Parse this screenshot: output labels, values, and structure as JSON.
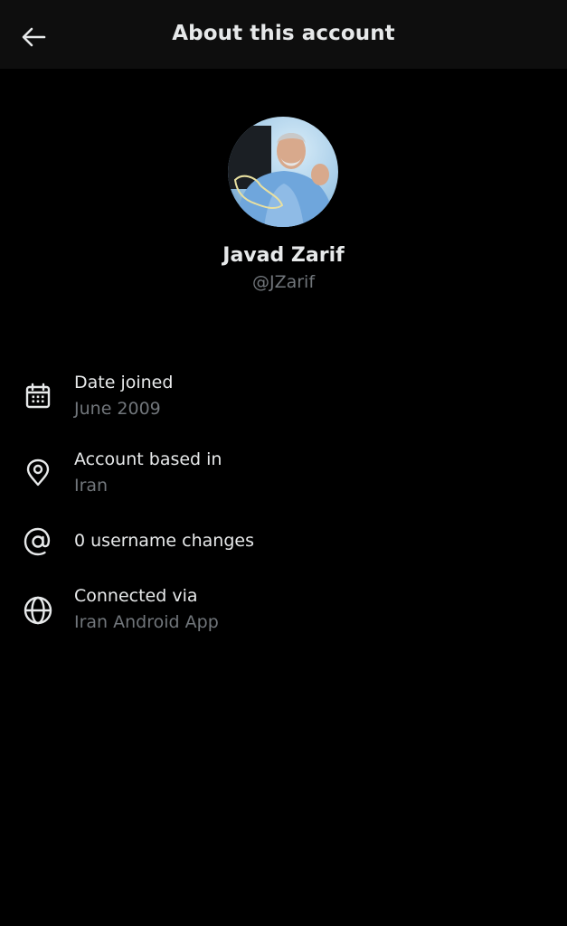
{
  "header": {
    "title": "About this account",
    "back_icon": "arrow-left-icon"
  },
  "profile": {
    "name": "Javad Zarif",
    "handle": "@JZarif"
  },
  "details": {
    "date_joined": {
      "icon": "calendar-icon",
      "label": "Date joined",
      "value": "June 2009"
    },
    "account_based_in": {
      "icon": "location-pin-icon",
      "label": "Account based in",
      "value": "Iran"
    },
    "username_changes": {
      "icon": "at-sign-icon",
      "label": "0 username changes"
    },
    "connected_via": {
      "icon": "globe-icon",
      "label": "Connected via",
      "value": "Iran Android App"
    }
  },
  "colors": {
    "background": "#000000",
    "header_background": "#0e0e0e",
    "primary_text": "#e7e9ea",
    "secondary_text": "#71767b"
  }
}
